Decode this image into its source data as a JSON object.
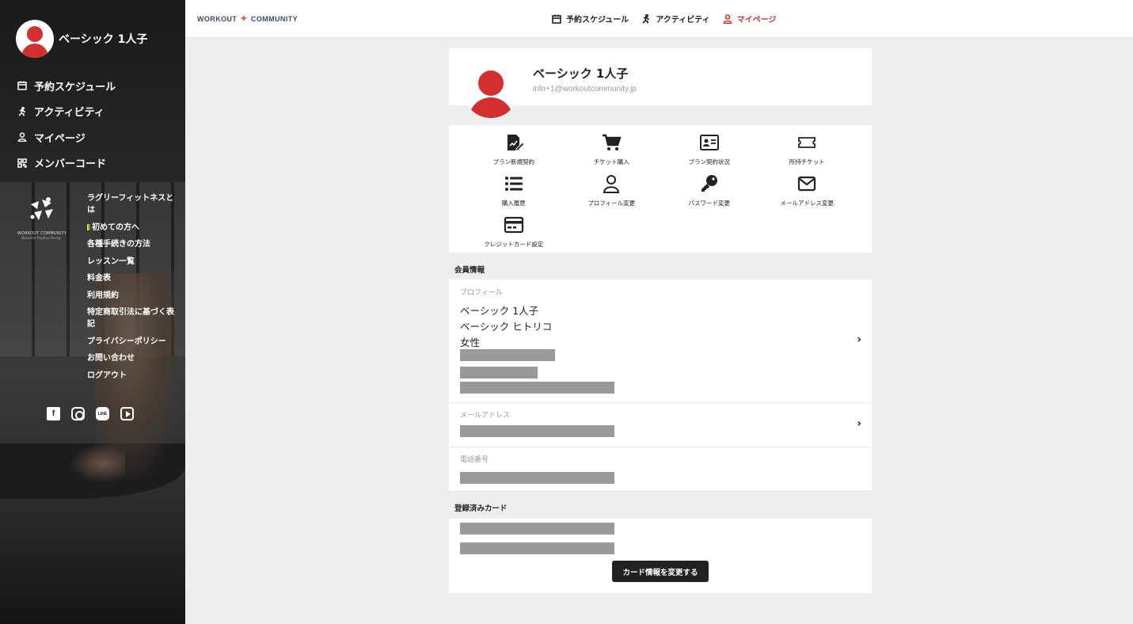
{
  "user": {
    "name": "ベーシック 1人子",
    "email": "info+1@workoutcommunity.jp"
  },
  "sidebar": {
    "nav": [
      {
        "label": "予約スケジュール",
        "icon": "calendar-icon"
      },
      {
        "label": "アクティビティ",
        "icon": "runner-icon"
      },
      {
        "label": "マイページ",
        "icon": "person-icon"
      },
      {
        "label": "メンバーコード",
        "icon": "qr-code-icon"
      }
    ],
    "logo": {
      "text": "WORKOUT COMMUNITY",
      "tagline": "Beautiful Positive Strong"
    },
    "links": [
      "ラグリーフィットネスとは",
      "初めての方へ",
      "各種手続きの方法",
      "レッスン一覧",
      "料金表",
      "利用規約",
      "特定商取引法に基づく表記",
      "プライバシーポリシー",
      "お問い合わせ",
      "ログアウト"
    ],
    "social": [
      "facebook-icon",
      "instagram-icon",
      "line-icon",
      "youtube-icon"
    ]
  },
  "header": {
    "logo_left": "WORKOUT",
    "logo_right": "COMMUNITY",
    "nav": [
      {
        "label": "予約スケジュール",
        "icon": "calendar-icon",
        "active": false
      },
      {
        "label": "アクティビティ",
        "icon": "runner-icon",
        "active": false
      },
      {
        "label": "マイページ",
        "icon": "person-icon",
        "active": true
      }
    ]
  },
  "menu": [
    {
      "label": "プラン新規契約",
      "icon": "contract-pen-icon"
    },
    {
      "label": "チケット購入",
      "icon": "cart-icon"
    },
    {
      "label": "プラン契約状況",
      "icon": "id-card-icon"
    },
    {
      "label": "所持チケット",
      "icon": "ticket-icon"
    },
    {
      "label": "購入履歴",
      "icon": "list-icon"
    },
    {
      "label": "プロフィール変更",
      "icon": "user-icon"
    },
    {
      "label": "パスワード変更",
      "icon": "key-icon"
    },
    {
      "label": "メールアドレス変更",
      "icon": "envelope-icon"
    },
    {
      "label": "クレジットカード設定",
      "icon": "credit-card-icon"
    }
  ],
  "member_info": {
    "title": "会員情報",
    "profile_label": "プロフィール",
    "profile_lines": [
      "ベーシック 1人子",
      "ベーシック ヒトリコ",
      "女性"
    ],
    "email_label": "メールアドレス",
    "phone_label": "電話番号"
  },
  "registered_card": {
    "title": "登録済みカード",
    "button_label": "カード情報を変更する"
  },
  "colors": {
    "accent": "#d32f2f",
    "dark": "#222222",
    "background": "#eeeeee"
  }
}
